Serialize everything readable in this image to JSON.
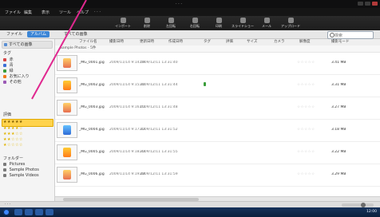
{
  "window": {
    "title": "· · ·",
    "menu": [
      "ファイル",
      "編集",
      "表示",
      "ツール",
      "ヘルプ",
      "· · ·"
    ]
  },
  "toolbar": {
    "buttons": [
      {
        "label": "インポート",
        "icon": "import-icon"
      },
      {
        "label": "削除",
        "icon": "delete-icon"
      },
      {
        "label": "左回転",
        "icon": "rotate-left-icon"
      },
      {
        "label": "右回転",
        "icon": "rotate-right-icon"
      },
      {
        "label": "印刷",
        "icon": "print-icon"
      },
      {
        "label": "スライドショー",
        "icon": "slideshow-icon"
      },
      {
        "label": "メール",
        "icon": "mail-icon"
      },
      {
        "label": "アップロード",
        "icon": "upload-icon"
      }
    ]
  },
  "tabs": {
    "items": [
      "ファイル",
      "アルバム",
      "すべての画像"
    ],
    "active_index": 1
  },
  "search": {
    "placeholder": "検索"
  },
  "sidebar": {
    "top_label": "すべての画像",
    "section_tags_label": "タグ",
    "tags": [
      {
        "label": "赤",
        "color": "#d64545"
      },
      {
        "label": "青",
        "color": "#3c6fd6"
      },
      {
        "label": "緑",
        "color": "#3a9d3a"
      },
      {
        "label": "お気に入り",
        "color": "#f07a1a"
      },
      {
        "label": "その他",
        "color": "#9b59b6"
      }
    ],
    "section_rating_label": "評価",
    "ratings": [
      "★★★★★",
      "★★★★☆",
      "★★★☆☆",
      "★★☆☆☆",
      "★☆☆☆☆"
    ],
    "section_folders_label": "フォルダー",
    "folders": [
      "Pictures",
      "Sample Photos",
      "Sample Videos"
    ]
  },
  "table": {
    "headers": [
      "ファイル名",
      "撮影日時",
      "更新日時",
      "作成日時",
      "タグ",
      "評価",
      "サイズ",
      "カメラ",
      "解像度",
      "撮影モード"
    ],
    "group_label": "Sample Photos - 5件",
    "rows": [
      {
        "filename": "_MG_0001.jpg",
        "date1": "2009/11/14 9:14:59",
        "date2": "2009/12/11 13:31:40",
        "size": "3.41 MB",
        "thumb": "warm",
        "flag": false
      },
      {
        "filename": "_MG_0002.jpg",
        "date1": "2009/11/14 9:15:10",
        "date2": "2009/12/11 13:31:44",
        "size": "3.31 MB",
        "thumb": "orange",
        "flag": true
      },
      {
        "filename": "_MG_0003.jpg",
        "date1": "2009/11/14 9:16:01",
        "date2": "2009/12/11 13:31:48",
        "size": "3.27 MB",
        "thumb": "warm",
        "flag": false
      },
      {
        "filename": "_MG_0004.jpg",
        "date1": "2009/11/14 9:17:12",
        "date2": "2009/12/11 13:31:52",
        "size": "3.18 MB",
        "thumb": "blue",
        "flag": false
      },
      {
        "filename": "_MG_0005.jpg",
        "date1": "2009/11/14 9:18:33",
        "date2": "2009/12/11 13:31:55",
        "size": "3.22 MB",
        "thumb": "orange",
        "flag": false
      },
      {
        "filename": "_MG_0006.jpg",
        "date1": "2009/11/14 9:19:44",
        "date2": "2009/12/11 13:31:59",
        "size": "3.29 MB",
        "thumb": "warm",
        "flag": false
      }
    ],
    "rating_placeholder": "☆☆☆☆☆"
  },
  "status": {
    "text": "· · ·",
    "zoom_level": 0.7
  },
  "taskbar": {
    "tray_text": "12:00"
  },
  "colors": {
    "accent": "#3d86d6",
    "pink_annotation": "#e0288f",
    "selected": "#ffd34d"
  }
}
